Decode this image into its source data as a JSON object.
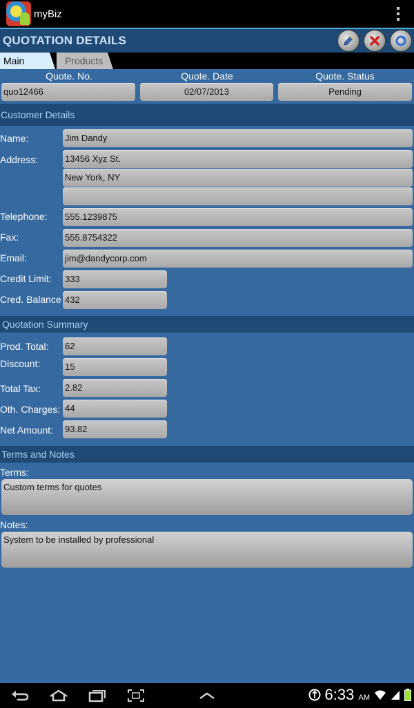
{
  "app": {
    "title": "myBiz"
  },
  "header": {
    "title": "QUOTATION DETAILS",
    "buttons": [
      "edit-icon",
      "close-icon",
      "sync-icon"
    ]
  },
  "tabs": [
    {
      "label": "Main page",
      "active": true
    },
    {
      "label": "Products",
      "active": false
    }
  ],
  "quote": {
    "no_label": "Quote. No.",
    "no_value": "quo12466",
    "date_label": "Quote. Date",
    "date_value": "02/07/2013",
    "status_label": "Quote. Status",
    "status_value": "Pending"
  },
  "customer": {
    "section_title": "Customer Details",
    "name_label": "Name:",
    "name_value": "Jim Dandy",
    "address_label": "Address:",
    "address_line1": "13456 Xyz St.",
    "address_line2": "New York, NY",
    "address_line3": "",
    "telephone_label": "Telephone:",
    "telephone_value": "555.1239875",
    "fax_label": "Fax:",
    "fax_value": "555.8754322",
    "email_label": "Email:",
    "email_value": "jim@dandycorp.com",
    "credit_limit_label": "Credit Limit:",
    "credit_limit_value": "333",
    "cred_balance_label": "Cred. Balance",
    "cred_balance_value": "432"
  },
  "summary": {
    "section_title": "Quotation Summary",
    "prod_total_label": "Prod. Total:",
    "prod_total_value": "62",
    "discount_label": "Discount:",
    "discount_value": "15",
    "total_tax_label": "Total Tax:",
    "total_tax_value": "2.82",
    "oth_charges_label": "Oth. Charges:",
    "oth_charges_value": "44",
    "net_amount_label": "Net Amount:",
    "net_amount_value": "93.82"
  },
  "terms": {
    "section_title": "Terms and Notes",
    "terms_label": "Terms:",
    "terms_value": "Custom terms for quotes",
    "notes_label": "Notes:",
    "notes_value": "System to be installed by professional"
  },
  "statusbar": {
    "time": "6:33",
    "ampm": "AM"
  },
  "colors": {
    "background": "#36699f",
    "section": "#1e4a75",
    "accent": "#4fa9d8",
    "field": "#b8b8b8"
  }
}
